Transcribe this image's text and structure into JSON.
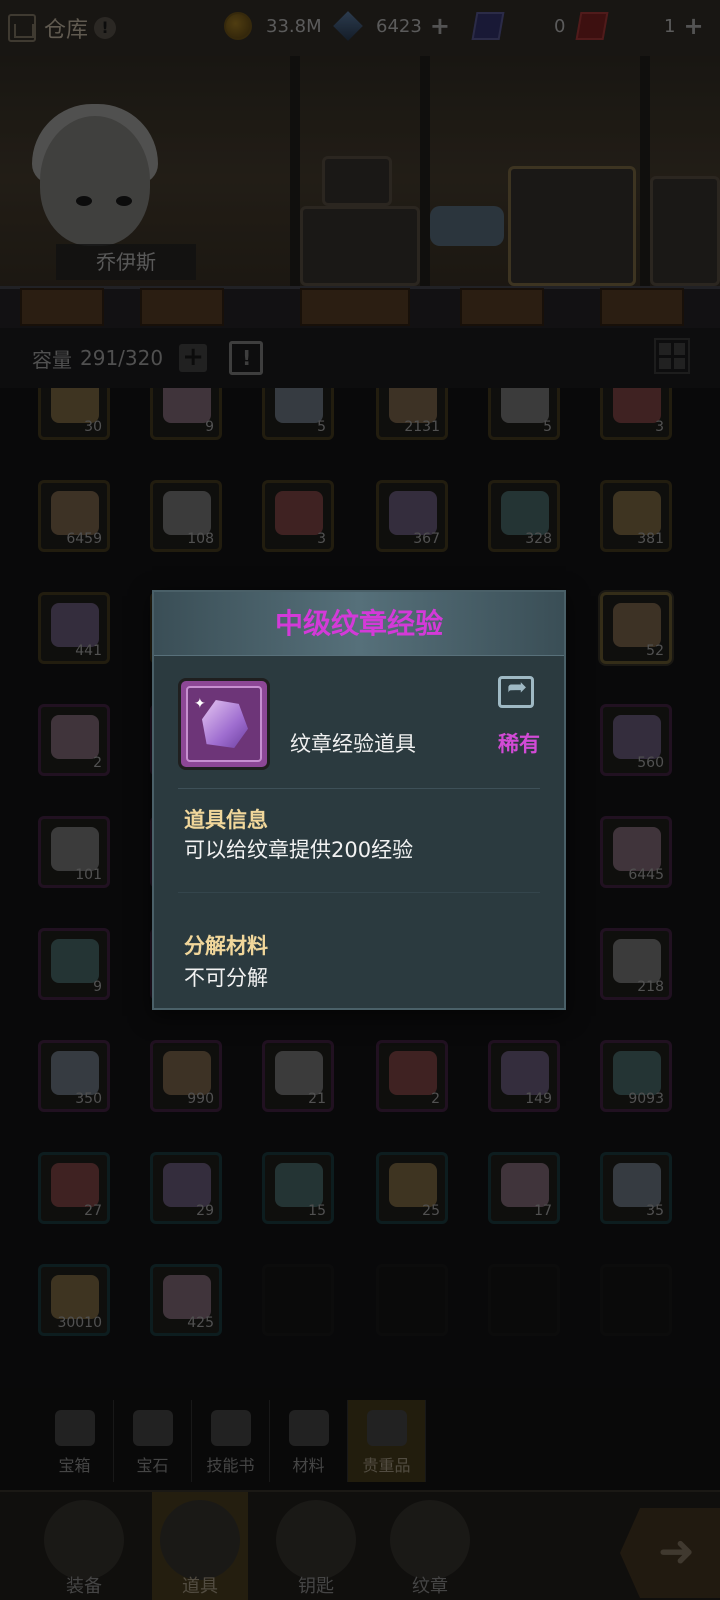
{
  "top_bar": {
    "title": "仓库",
    "resources": [
      {
        "icon": "gold-coin-icon",
        "value": "33.8M",
        "addable": false
      },
      {
        "icon": "blue-gem-icon",
        "value": "6423",
        "addable": true
      },
      {
        "icon": "blue-ticket-icon",
        "value": "0",
        "addable": false
      },
      {
        "icon": "red-ticket-icon",
        "value": "1",
        "addable": true
      }
    ]
  },
  "scene": {
    "character_name": "乔伊斯"
  },
  "capacity": {
    "label": "容量",
    "value": "291/320"
  },
  "inventory": {
    "rows": [
      [
        "30",
        "9",
        "5",
        "2131",
        "5",
        "3"
      ],
      [
        "6459",
        "108",
        "3",
        "367",
        "328",
        "381"
      ],
      [
        "441",
        "",
        "",
        "",
        "",
        "52"
      ],
      [
        "2",
        "",
        "",
        "",
        "",
        "560"
      ],
      [
        "101",
        "",
        "",
        "",
        "",
        "6445"
      ],
      [
        "9",
        "",
        "",
        "",
        "",
        "218"
      ],
      [
        "350",
        "990",
        "21",
        "2",
        "149",
        "9093"
      ],
      [
        "27",
        "29",
        "15",
        "25",
        "17",
        "35"
      ],
      [
        "30010",
        "425"
      ]
    ]
  },
  "categories": [
    {
      "label": "宝箱",
      "icon": "chest-icon"
    },
    {
      "label": "宝石",
      "icon": "diamond-icon"
    },
    {
      "label": "技能书",
      "icon": "book-icon"
    },
    {
      "label": "材料",
      "icon": "material-icon"
    },
    {
      "label": "贵重品",
      "icon": "valuables-icon",
      "active": true
    }
  ],
  "nav": [
    {
      "label": "装备",
      "icon": "equipment-icon"
    },
    {
      "label": "道具",
      "icon": "items-icon",
      "active": true
    },
    {
      "label": "钥匙",
      "icon": "key-icon"
    },
    {
      "label": "纹章",
      "icon": "emblem-icon"
    }
  ],
  "popup": {
    "title": "中级纹章经验",
    "item_type": "纹章经验道具",
    "rarity": "稀有",
    "info_title": "道具信息",
    "info_body": "可以给纹章提供200经验",
    "decompose_title": "分解材料",
    "decompose_body": "不可分解"
  },
  "colors": {
    "rarity_purple": "#d33ad8",
    "popup_bg": "#2b3a3f",
    "section_title": "#f1d79b"
  }
}
